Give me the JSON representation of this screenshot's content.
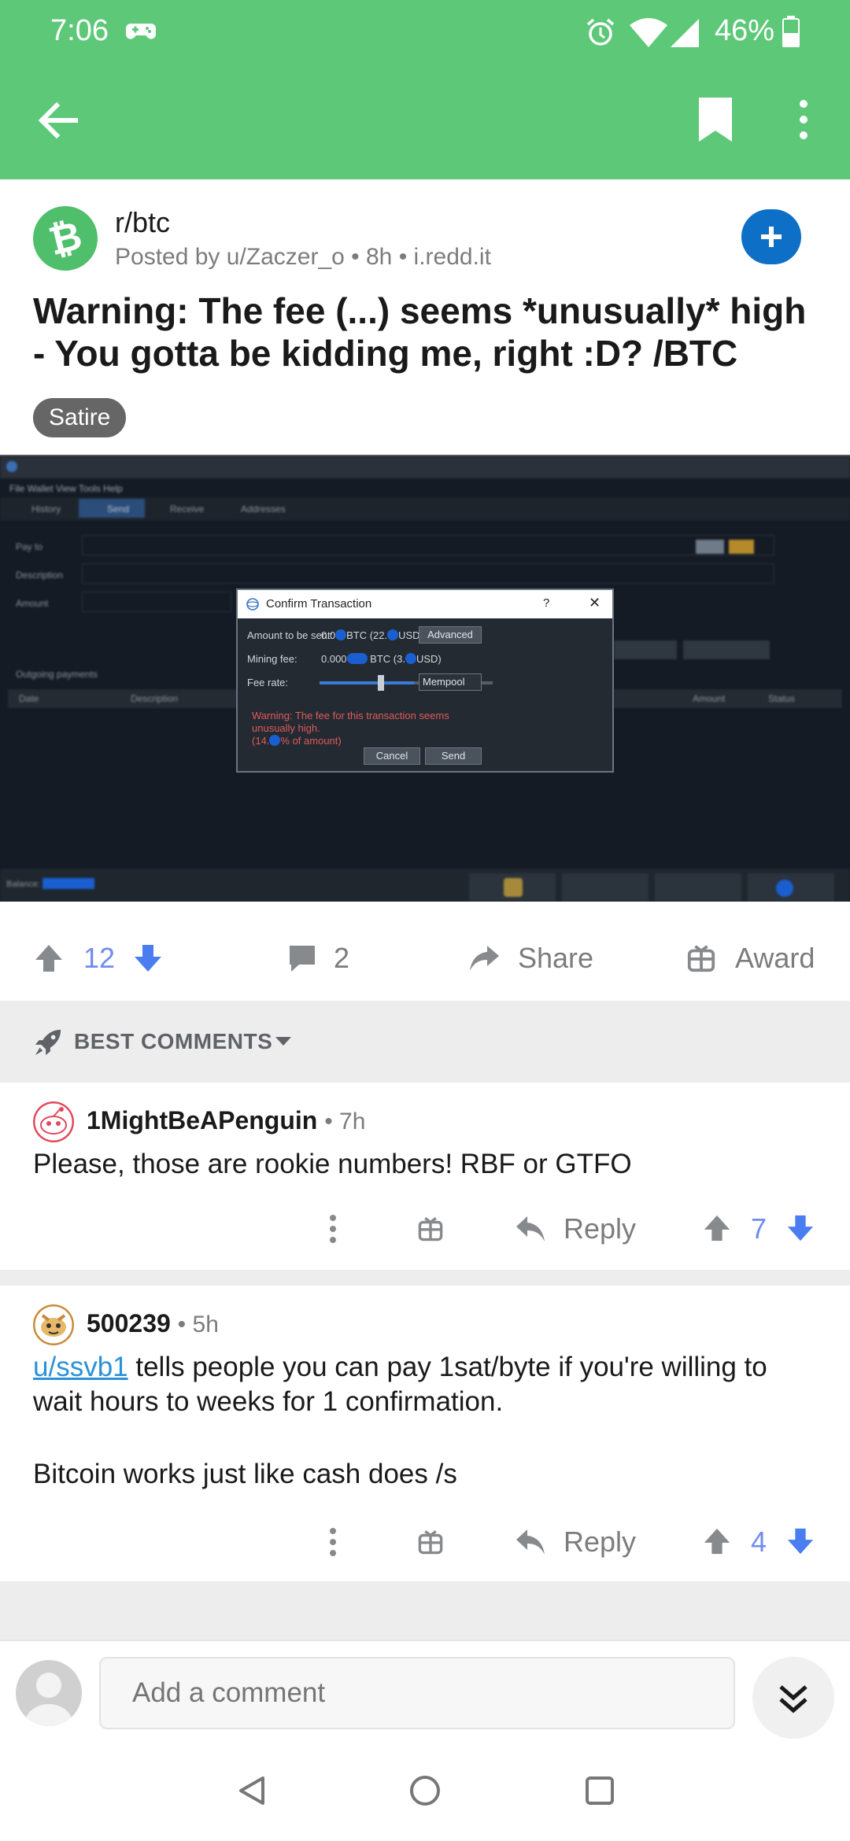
{
  "status_bar": {
    "time": "7:06",
    "battery": "46%"
  },
  "post": {
    "subreddit": "r/btc",
    "meta": "Posted by u/Zaczer_o • 8h • i.redd.it",
    "title": "Warning: The fee (...) seems *unusually* high - You gotta be kidding me, right :D? /BTC",
    "flair": "Satire",
    "image": {
      "menu": "File  Wallet  View  Tools  Help",
      "tabs": [
        "History",
        "Send",
        "Receive",
        "Addresses"
      ],
      "form_labels": [
        "Pay to",
        "Description",
        "Amount"
      ],
      "outgoing": "Outgoing payments",
      "cols": [
        "Date",
        "Description",
        "Amount",
        "Status"
      ],
      "balance": "Balance:",
      "dialog": {
        "title": "Confirm Transaction",
        "help": "?",
        "close": "✕",
        "amount_label": "Amount to be sent:",
        "amount_a": "0.0",
        "amount_b": "BTC (22.",
        "amount_c": "USD)",
        "fee_label": "Mining fee:",
        "fee_a": "0.000",
        "fee_b": "BTC (3.",
        "fee_c": "USD)",
        "rate_label": "Fee rate:",
        "mempool": "Mempool",
        "advanced": "Advanced",
        "warning_1": "Warning: The fee for this transaction seems unusually high.",
        "warning_2a": "(14.",
        "warning_2b": "% of amount)",
        "cancel": "Cancel",
        "send": "Send"
      }
    },
    "votes": "12",
    "comments": "2",
    "share": "Share",
    "award": "Award"
  },
  "sort": {
    "label": "BEST COMMENTS"
  },
  "comments": [
    {
      "author": "1MightBeAPenguin",
      "time": "• 7h",
      "body": "Please, those are rookie numbers! RBF or GTFO",
      "reply": "Reply",
      "votes": "7"
    },
    {
      "author": "500239",
      "time": "• 5h",
      "link": "u/ssvb1",
      "body_1": " tells people you can pay 1sat/byte if you're willing to wait hours to weeks for 1 confirmation.",
      "body_2": "Bitcoin works just like cash does /s",
      "reply": "Reply",
      "votes": "4"
    }
  ],
  "composer": {
    "placeholder": "Add a comment"
  },
  "colors": {
    "header": "#5dc978",
    "upvote_count": "#6f8df0",
    "downvote": "#4a7df0",
    "link": "#2a91d6"
  }
}
